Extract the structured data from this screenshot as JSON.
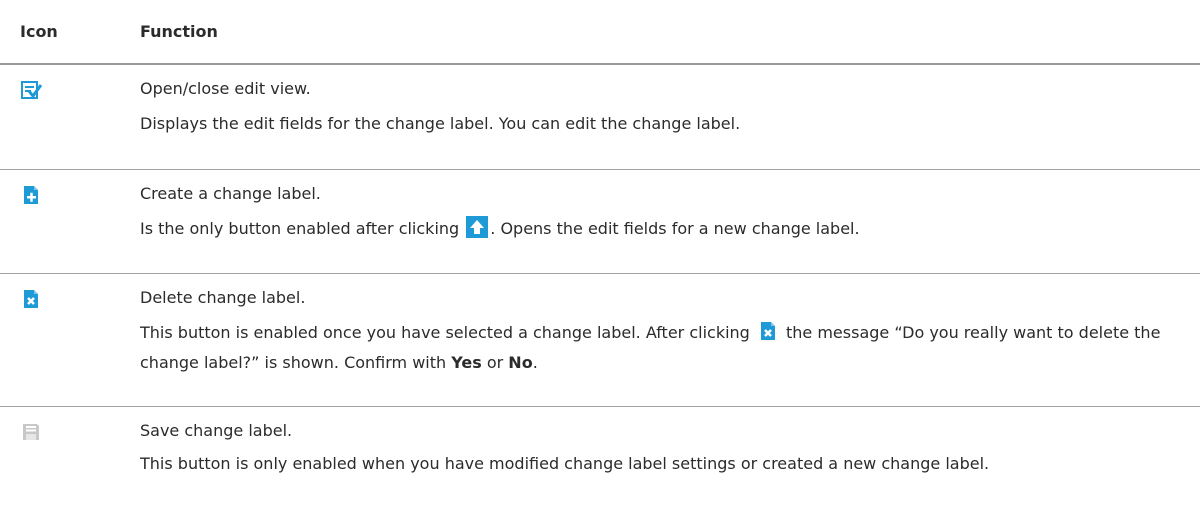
{
  "header": {
    "icon_col": "Icon",
    "function_col": "Function"
  },
  "rows": [
    {
      "icon": "edit-view-icon",
      "title": "Open/close edit view.",
      "desc": "Displays the edit fields for the change label. You can edit the change label."
    },
    {
      "icon": "add-document-icon",
      "title": "Create a change label.",
      "desc_a": "Is the only button enabled after clicking ",
      "desc_icon": "upload-arrow-icon",
      "desc_b": ". Opens the edit fields for a new change label."
    },
    {
      "icon": "delete-document-icon",
      "title": "Delete change label.",
      "desc_a": "This button is enabled once you have selected a change label. After clicking ",
      "desc_icon": "delete-document-icon",
      "desc_b": " the message “Do you really want to delete the change label?” is shown. Confirm with ",
      "desc_yes": "Yes",
      "desc_or": " or ",
      "desc_no": "No",
      "desc_end": "."
    },
    {
      "icon": "save-disabled-icon",
      "title": "Save change label.",
      "desc": "This button is only enabled when you have modified change label settings or created a new change label."
    }
  ],
  "colors": {
    "accent": "#1e9ad6",
    "disabled": "#c8c8c8",
    "rule": "#9a9a9a"
  }
}
